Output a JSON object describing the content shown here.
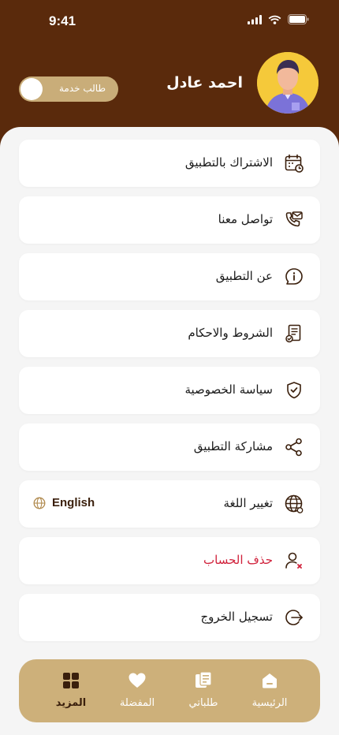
{
  "status_bar": {
    "time": "9:41",
    "icons": [
      "signal-icon",
      "wifi-icon",
      "battery-icon"
    ]
  },
  "profile": {
    "name": "احمد عادل",
    "toggle_label": "طالب خدمة"
  },
  "menu": {
    "items": [
      {
        "label": "الاشتراك بالتطبيق",
        "icon": "calendar-icon"
      },
      {
        "label": "تواصل معنا",
        "icon": "phone-mail-icon"
      },
      {
        "label": "عن التطبيق",
        "icon": "info-icon"
      },
      {
        "label": "الشروط والاحكام",
        "icon": "document-icon"
      },
      {
        "label": "سياسة الخصوصية",
        "icon": "shield-icon"
      },
      {
        "label": "مشاركة التطبيق",
        "icon": "share-icon"
      },
      {
        "label": "تغيير اللغة",
        "icon": "globe-icon",
        "value": "English"
      },
      {
        "label": "حذف الحساب",
        "icon": "user-delete-icon"
      },
      {
        "label": "تسجيل الخروج",
        "icon": "logout-icon"
      }
    ]
  },
  "bottom_nav": {
    "items": [
      {
        "label": "الرئيسية",
        "icon": "home-icon"
      },
      {
        "label": "طلباتي",
        "icon": "orders-icon"
      },
      {
        "label": "المفضلة",
        "icon": "heart-icon"
      },
      {
        "label": "المزيد",
        "icon": "grid-icon",
        "active": true
      }
    ]
  },
  "colors": {
    "header": "#5a2a0c",
    "accent": "#cdb07a",
    "danger": "#d0203a",
    "dark_brown": "#3a1f0c"
  }
}
